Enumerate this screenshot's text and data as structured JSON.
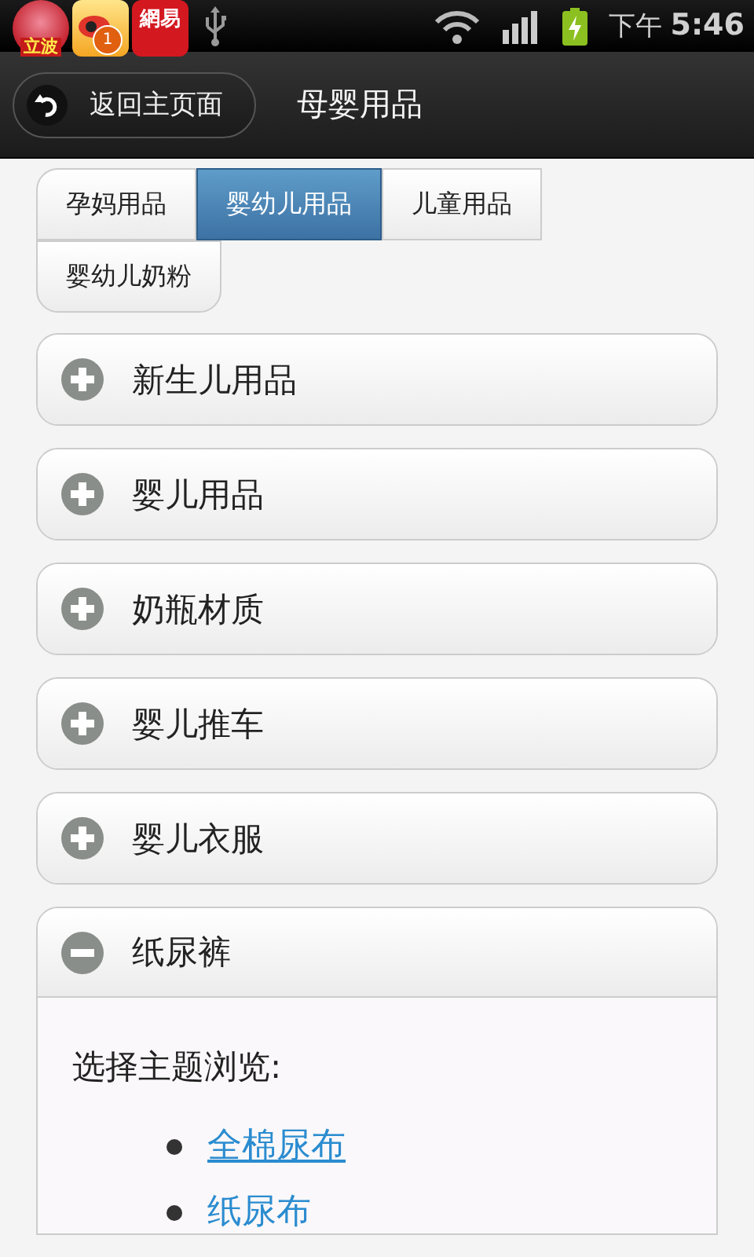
{
  "status_bar": {
    "notifications": [
      {
        "kind": "frog-app",
        "label": "立波"
      },
      {
        "kind": "bird-app",
        "badge": "1"
      },
      {
        "kind": "news-app",
        "label": "網易"
      },
      {
        "kind": "usb"
      }
    ],
    "time_prefix": "下午",
    "time": "5:46"
  },
  "header": {
    "back_button": "返回主页面",
    "title": "母婴用品"
  },
  "tabs": [
    {
      "label": "孕妈用品",
      "selected": false
    },
    {
      "label": "婴幼儿用品",
      "selected": true
    },
    {
      "label": "儿童用品",
      "selected": false
    },
    {
      "label": "婴幼儿奶粉",
      "selected": false
    }
  ],
  "sections": [
    {
      "title": "新生儿用品",
      "expanded": false
    },
    {
      "title": "婴儿用品",
      "expanded": false
    },
    {
      "title": "奶瓶材质",
      "expanded": false
    },
    {
      "title": "婴儿推车",
      "expanded": false
    },
    {
      "title": "婴儿衣服",
      "expanded": false
    },
    {
      "title": "纸尿裤",
      "expanded": true,
      "prompt": "选择主题浏览:",
      "links": [
        "全棉尿布",
        "纸尿布"
      ]
    }
  ]
}
